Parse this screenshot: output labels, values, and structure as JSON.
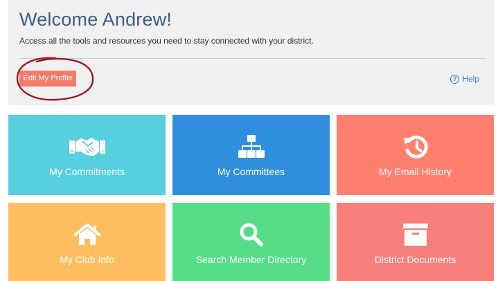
{
  "header": {
    "title": "Welcome Andrew!",
    "subtitle": "Access all the tools and resources you need to stay connected with your district.",
    "edit_profile_label": "Edit My Profile",
    "help_label": "Help",
    "help_icon": "question-circle-icon"
  },
  "tiles": [
    {
      "label": "My Commitments",
      "icon": "handshake-icon",
      "color": "#56d0df"
    },
    {
      "label": "My Committees",
      "icon": "org-chart-icon",
      "color": "#2f8fde"
    },
    {
      "label": "My Email History",
      "icon": "history-icon",
      "color": "#ff7f6e"
    },
    {
      "label": "My Club Info",
      "icon": "home-icon",
      "color": "#ffbf60"
    },
    {
      "label": "Search Member Directory",
      "icon": "search-icon",
      "color": "#55de87"
    },
    {
      "label": "District Documents",
      "icon": "archive-box-icon",
      "color": "#f87f7c"
    }
  ],
  "colors": {
    "title": "#3d5f82",
    "edit_button": "#f47b6b",
    "annotation_circle": "#9b1c24",
    "link": "#2b7bd4"
  }
}
